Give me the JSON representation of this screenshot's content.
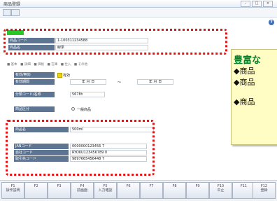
{
  "window": {
    "title": "商品登録"
  },
  "fields": {
    "product_code": {
      "label": "商品コード",
      "value": "1-100311234588"
    },
    "product_name": {
      "label": "商品名",
      "value": "緑茶"
    },
    "active_flag": {
      "label": "有効/無効",
      "value": "有効"
    },
    "valid_period": {
      "label": "有効期間",
      "from": "年 月 日",
      "separator": "〜",
      "to": "年 月 日"
    },
    "category_code": {
      "label": "分類コード/名称",
      "value": "5678ｶ"
    },
    "product_type": {
      "label": "商品区分",
      "value": "一般商品"
    },
    "spec_name": {
      "label": "商品名",
      "value": "500ml"
    },
    "jan_code": {
      "label": "JANコード",
      "value": "0000000123456 7"
    },
    "own_code": {
      "label": "自社コード",
      "value": "RYOKU123456789 0"
    },
    "other_code": {
      "label": "取引先コード",
      "value": "9897665456448 7"
    }
  },
  "legend_line": "■ 基本　■ 詳細　■ 価格　■ 在庫　■ 仕入　■ その他",
  "callout": {
    "header": "豊富な",
    "bullets": [
      "◆商品",
      "◆商品",
      "◆商品"
    ]
  },
  "footer": {
    "keys": [
      {
        "key": "F1",
        "label": "操作説明"
      },
      {
        "key": "F2",
        "label": ""
      },
      {
        "key": "F3",
        "label": ""
      },
      {
        "key": "F4",
        "label": "前画面"
      },
      {
        "key": "F5",
        "label": "入力確認"
      },
      {
        "key": "F6",
        "label": ""
      },
      {
        "key": "F7",
        "label": ""
      },
      {
        "key": "F8",
        "label": ""
      },
      {
        "key": "F9",
        "label": ""
      },
      {
        "key": "F10",
        "label": "中止"
      },
      {
        "key": "F11",
        "label": ""
      },
      {
        "key": "F12",
        "label": "登録"
      }
    ]
  },
  "colors": {
    "accent_red": "#e01414",
    "label_bg": "#5d7493",
    "highlight_green": "#28c828",
    "callout_green": "#0a7f2c"
  }
}
